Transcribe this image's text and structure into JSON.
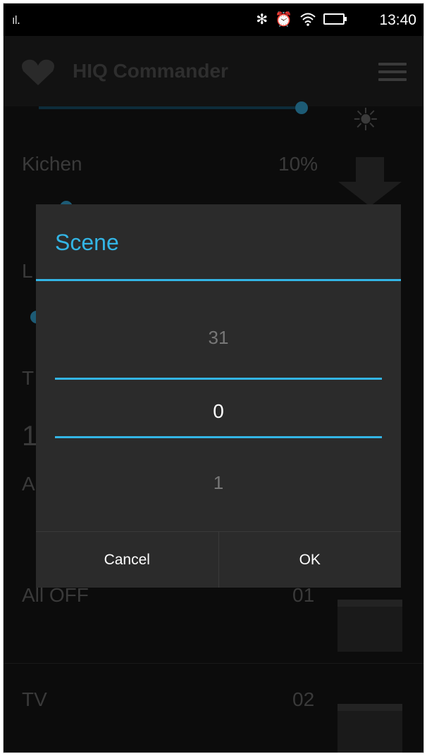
{
  "status_bar": {
    "signal": "ıl.",
    "bluetooth": "✻",
    "alarm": "⏰",
    "wifi": "wifi",
    "time": "13:40"
  },
  "app_bar": {
    "title": "HIQ Commander",
    "logo_icon": "heart-icon",
    "menu_icon": "hamburger-menu-icon"
  },
  "background_list": {
    "rows": [
      {
        "name": "Kichen",
        "value": "10%"
      },
      {
        "name": "L",
        "value": ""
      },
      {
        "name": "T",
        "value": ""
      },
      {
        "name": "1",
        "value": ""
      },
      {
        "name": "A",
        "value": ""
      },
      {
        "name": "All OFF",
        "value": "01"
      },
      {
        "name": "TV",
        "value": "02"
      }
    ]
  },
  "dialog": {
    "title": "Scene",
    "picker": {
      "previous": "31",
      "current": "0",
      "next": "1"
    },
    "cancel_label": "Cancel",
    "ok_label": "OK"
  },
  "colors": {
    "accent": "#33b5e5",
    "dialog_bg": "#2b2b2b",
    "screen_bg": "#0c0c0c"
  }
}
